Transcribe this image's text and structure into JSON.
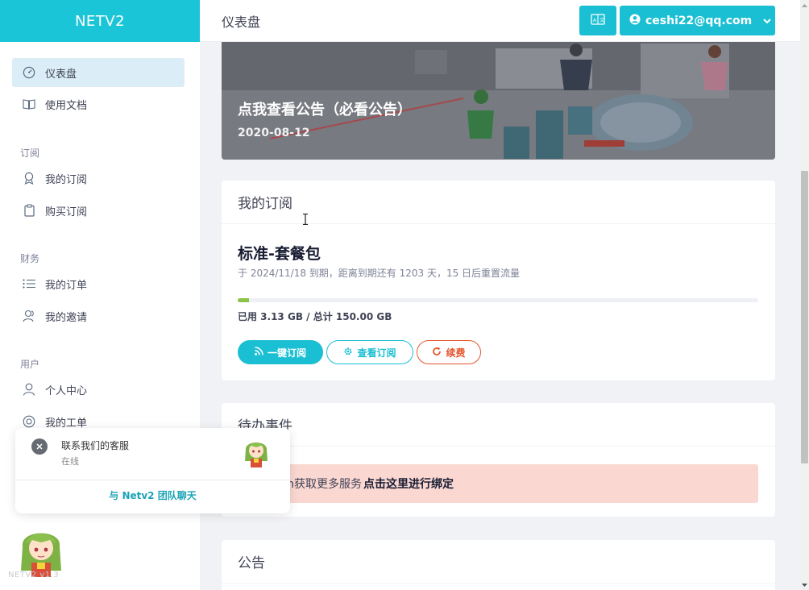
{
  "app": {
    "brand": "NETV2",
    "page_title": "仪表盘"
  },
  "header": {
    "user_email": "ceshi22@qq.com",
    "accent": "#1bc5d8"
  },
  "sidebar": {
    "items": [
      {
        "label": "仪表盘",
        "icon": "dashboard-icon"
      },
      {
        "label": "使用文档",
        "icon": "book-icon"
      }
    ],
    "sections": [
      {
        "title": "订阅",
        "items": [
          {
            "label": "我的订阅",
            "icon": "badge-icon"
          },
          {
            "label": "购买订阅",
            "icon": "clipboard-icon"
          }
        ]
      },
      {
        "title": "财务",
        "items": [
          {
            "label": "我的订单",
            "icon": "list-icon"
          },
          {
            "label": "我的邀请",
            "icon": "users-icon"
          }
        ]
      },
      {
        "title": "用户",
        "items": [
          {
            "label": "个人中心",
            "icon": "user-icon"
          },
          {
            "label": "我的工单",
            "icon": "lifebuoy-icon"
          }
        ]
      }
    ]
  },
  "banner": {
    "title": "点我查看公告（必看公告）",
    "date": "2020-08-12"
  },
  "subscription": {
    "heading": "我的订阅",
    "plan_name": "标准-套餐包",
    "expiry_text": "于 2024/11/18 到期，距离到期还有 1203 天，15 日后重置流量",
    "usage_text": "已用 3.13 GB / 总计 150.00 GB",
    "usage_fraction": 0.0209,
    "buttons": {
      "one_click": "一键订阅",
      "view": "查看订阅",
      "renew": "续费"
    }
  },
  "todo": {
    "heading": "待办事件",
    "alert_text": "elegram获取更多服务",
    "alert_link": "点击这里进行绑定"
  },
  "notice": {
    "heading": "公告"
  },
  "chat": {
    "title": "联系我们的客服",
    "status": "在线",
    "link": "与 Netv2 团队聊天"
  },
  "footer": {
    "watermark": "NETV2 v1.3"
  }
}
